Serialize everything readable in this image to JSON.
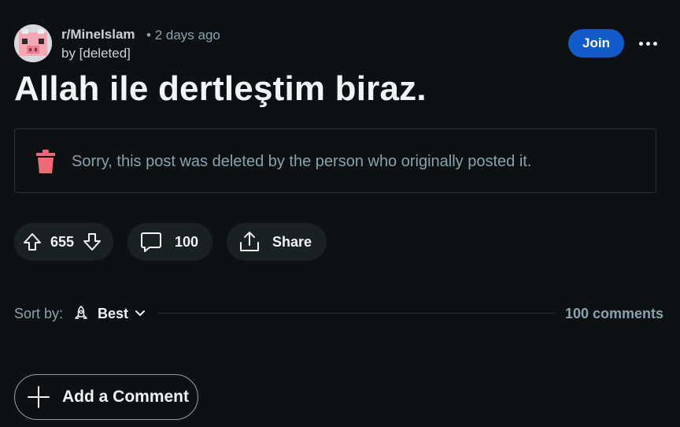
{
  "post": {
    "subreddit": "r/MineIslam",
    "separator": "•",
    "time": "2 days ago",
    "author": "by [deleted]",
    "join_label": "Join",
    "title": "Allah ile dertleştim biraz.",
    "deleted_notice": "Sorry, this post was deleted by the person who originally posted it."
  },
  "actions": {
    "vote_count": "655",
    "comment_count": "100",
    "share_label": "Share"
  },
  "sort": {
    "label": "Sort by:",
    "value": "Best",
    "total_comments": "100 comments"
  },
  "add_comment_label": "Add a Comment",
  "icons": {
    "avatar": "pig-avatar-icon",
    "more": "more-horizontal-icon",
    "trash": "trash-icon",
    "upvote": "upvote-icon",
    "downvote": "downvote-icon",
    "comment": "comment-icon",
    "share": "share-icon",
    "sort": "rocket-icon",
    "chevron": "chevron-down-icon",
    "add": "plus-icon"
  },
  "colors": {
    "background": "#0e1113",
    "join_button": "#115bca",
    "trash": "#f06a75",
    "muted_text": "#8ba2ad"
  }
}
